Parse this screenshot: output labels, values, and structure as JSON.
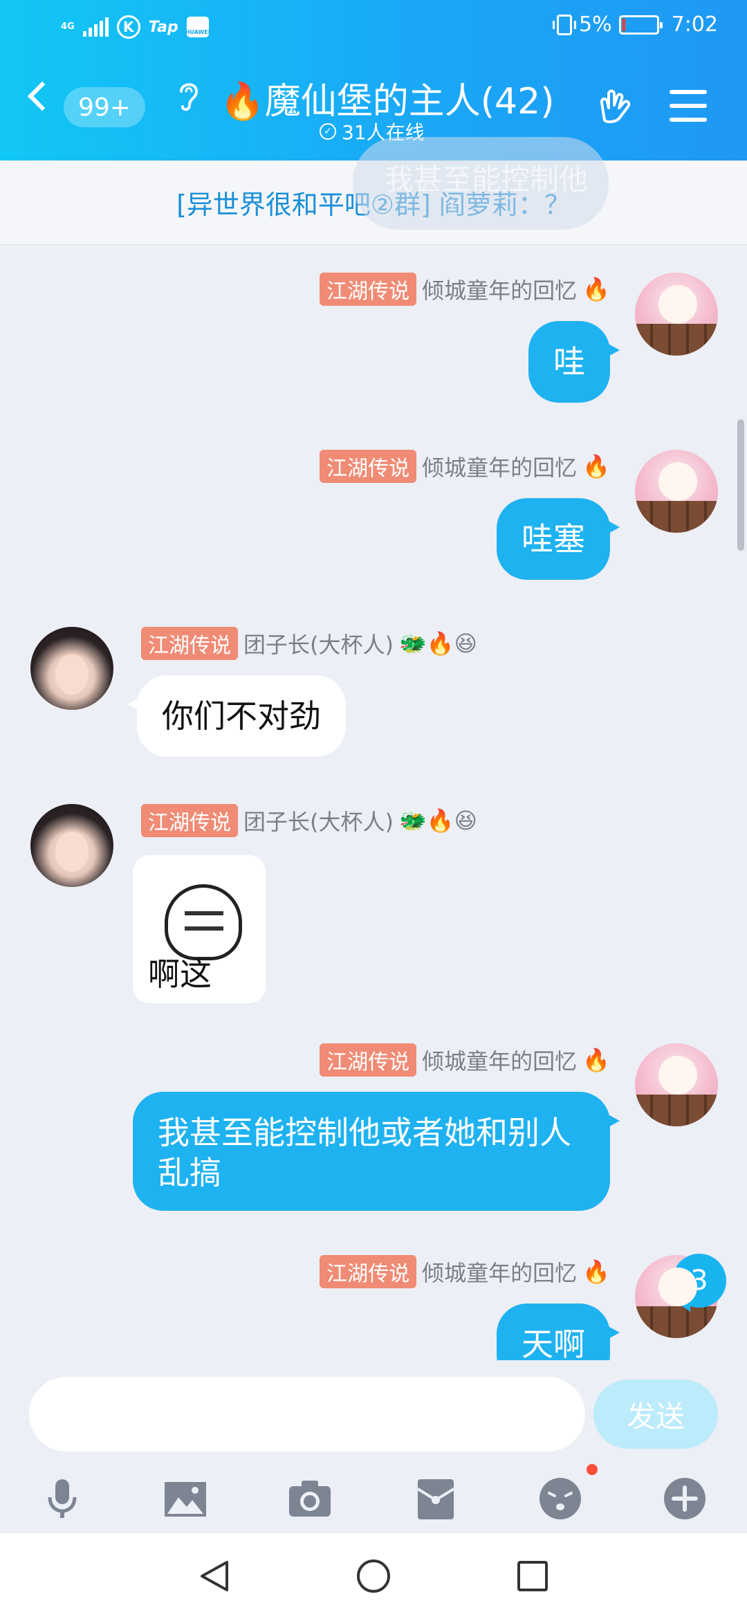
{
  "status_bar": {
    "network": "4G",
    "tap_label": "Tap",
    "huawei_label": "HUAWEI",
    "k_label": "K",
    "battery_percent": "5%",
    "time": "7:02",
    "battery_level": 0.05
  },
  "header": {
    "unread_count": "99+",
    "title": "🔥魔仙堡的主人(42)",
    "online": "31人在线"
  },
  "announcement": {
    "text": "[异世界很和平吧②群] 阎萝莉：？",
    "ghost_text": "我甚至能控制他"
  },
  "messages": [
    {
      "side": "me",
      "tag": "江湖传说",
      "name": "倾城童年的回忆",
      "badges": "🔥",
      "text": "哇"
    },
    {
      "side": "me",
      "tag": "江湖传说",
      "name": "倾城童年的回忆",
      "badges": "🔥",
      "text": "哇塞"
    },
    {
      "side": "other",
      "tag": "江湖传说",
      "name": "团子长(大杯人)",
      "badges": "🐲🔥😆",
      "text": "你们不对劲"
    },
    {
      "side": "other",
      "tag": "江湖传说",
      "name": "团子长(大杯人)",
      "badges": "🐲🔥😆",
      "sticker_text": "啊这"
    },
    {
      "side": "me",
      "tag": "江湖传说",
      "name": "倾城童年的回忆",
      "badges": "🔥",
      "text": "我甚至能控制他或者她和别人乱搞"
    },
    {
      "side": "me",
      "tag": "江湖传说",
      "name": "倾城童年的回忆",
      "badges": "🔥",
      "text": "天啊"
    }
  ],
  "new_message_count": "3",
  "input": {
    "placeholder": "",
    "send_label": "发送"
  },
  "toolbar_icons": [
    "microphone-icon",
    "image-icon",
    "camera-icon",
    "red-packet-icon",
    "emoji-icon",
    "plus-icon"
  ],
  "colors": {
    "accent": "#1fb2f0",
    "tag": "#f08b75",
    "header_start": "#12c7f5",
    "header_end": "#1f98f4"
  }
}
